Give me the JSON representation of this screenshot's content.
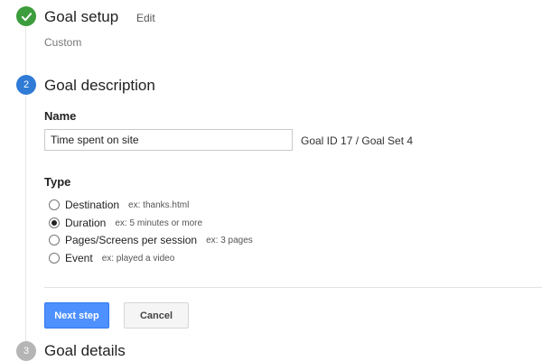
{
  "colors": {
    "complete": "#3c9d3c",
    "active": "#2f7bd6",
    "inactive": "#b5b5b5",
    "primary_button": "#4d90fe"
  },
  "steps": [
    {
      "number": "",
      "title": "Goal setup",
      "edit": "Edit",
      "summary": "Custom",
      "state": "complete",
      "icon": "check-icon"
    },
    {
      "number": "2",
      "title": "Goal description",
      "state": "active"
    },
    {
      "number": "3",
      "title": "Goal details",
      "state": "inactive"
    }
  ],
  "description": {
    "name_label": "Name",
    "name_value": "Time spent on site",
    "goal_id_text": "Goal ID 17 / Goal Set 4",
    "type_label": "Type",
    "selected_type": "Duration",
    "types": [
      {
        "label": "Destination",
        "example": "ex: thanks.html"
      },
      {
        "label": "Duration",
        "example": "ex: 5 minutes or more"
      },
      {
        "label": "Pages/Screens per session",
        "example": "ex: 3 pages"
      },
      {
        "label": "Event",
        "example": "ex: played a video"
      }
    ]
  },
  "buttons": {
    "next_label": "Next step",
    "cancel_label": "Cancel"
  }
}
